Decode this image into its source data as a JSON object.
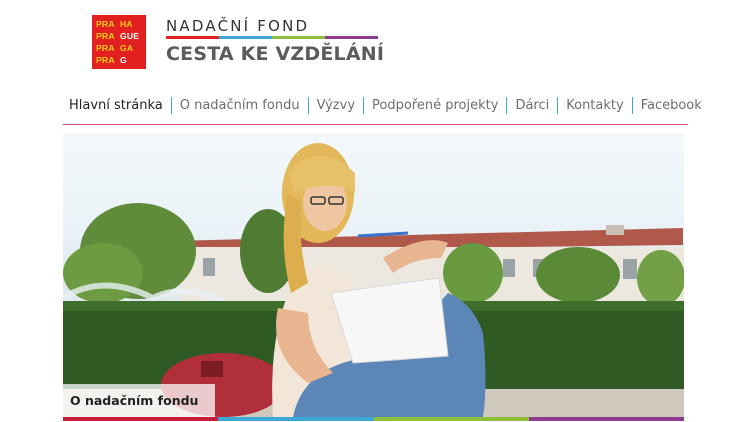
{
  "logo": {
    "cells": [
      "PRA",
      "HA",
      "PRA",
      "GUE",
      "PRA",
      "GA",
      "PRA",
      "G"
    ],
    "colors": {
      "background": "#e1201f",
      "yellow": "#f7d117",
      "white": "#ffffff"
    }
  },
  "header": {
    "fund_label": "NADAČNÍ FOND",
    "fund_name": "CESTA KE VZDĚLÁNÍ",
    "accent_colors": [
      "#e1201f",
      "#3fa7d6",
      "#8fbf3a",
      "#8e3b8f"
    ]
  },
  "nav": {
    "items": [
      {
        "label": "Hlavní stránka",
        "active": true
      },
      {
        "label": "O nadačním fondu"
      },
      {
        "label": "Výzvy"
      },
      {
        "label": "Podpořené projekty"
      },
      {
        "label": "Dárci"
      },
      {
        "label": "Kontakty"
      },
      {
        "label": "Facebook"
      }
    ],
    "separator_color": "#3fa7d6",
    "underline_color": "#c9596a"
  },
  "hero": {
    "caption": "O nadačním fondu",
    "bottom_colors": [
      "#c8203a",
      "#3fa7d6",
      "#8fbf3a",
      "#8e3b8f"
    ]
  }
}
